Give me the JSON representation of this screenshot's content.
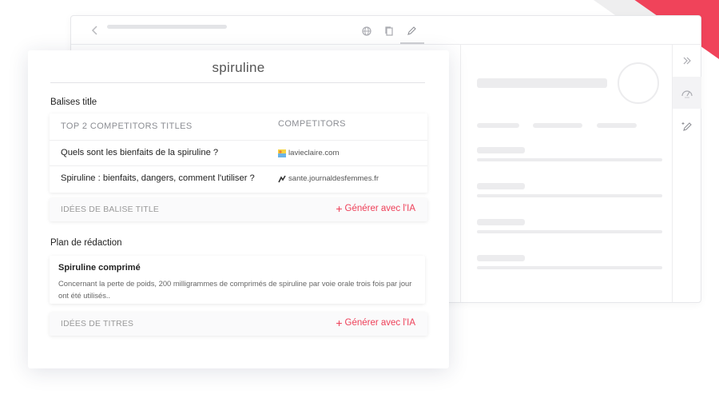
{
  "colors": {
    "accent": "#ee4059",
    "muted": "#8b8d93"
  },
  "browser": {
    "toolbar_icons": [
      "chevron-left-icon",
      "globe-icon",
      "copy-icon",
      "pen-icon"
    ],
    "rail_icons": [
      "double-chevron-right-icon",
      "gauge-icon",
      "magic-pen-icon"
    ]
  },
  "editor": {
    "keyword": "spiruline",
    "title_section": {
      "heading": "Balises title",
      "columns": [
        "TOP 2 COMPETITORS TITLES",
        "COMPETITORS"
      ],
      "rows": [
        {
          "title": "Quels sont les bienfaits de la spiruline ?",
          "competitor": "lavieclaire.com"
        },
        {
          "title": "Spiruline : bienfaits, dangers, comment l'utiliser ?",
          "competitor": "sante.journaldesfemmes.fr"
        }
      ],
      "ideas_label": "IDÉES DE BALISE TITLE",
      "generate_label": "Générer avec l'IA"
    },
    "outline_section": {
      "heading": "Plan de rédaction",
      "item_title": "Spiruline comprimé",
      "item_text": "Concernant la perte de poids, 200 milligrammes de comprimés de spiruline par voie orale trois fois par jour ont été utilisés..",
      "ideas_label": "IDÉES DE TITRES",
      "generate_label": "Générer avec l'IA"
    }
  }
}
